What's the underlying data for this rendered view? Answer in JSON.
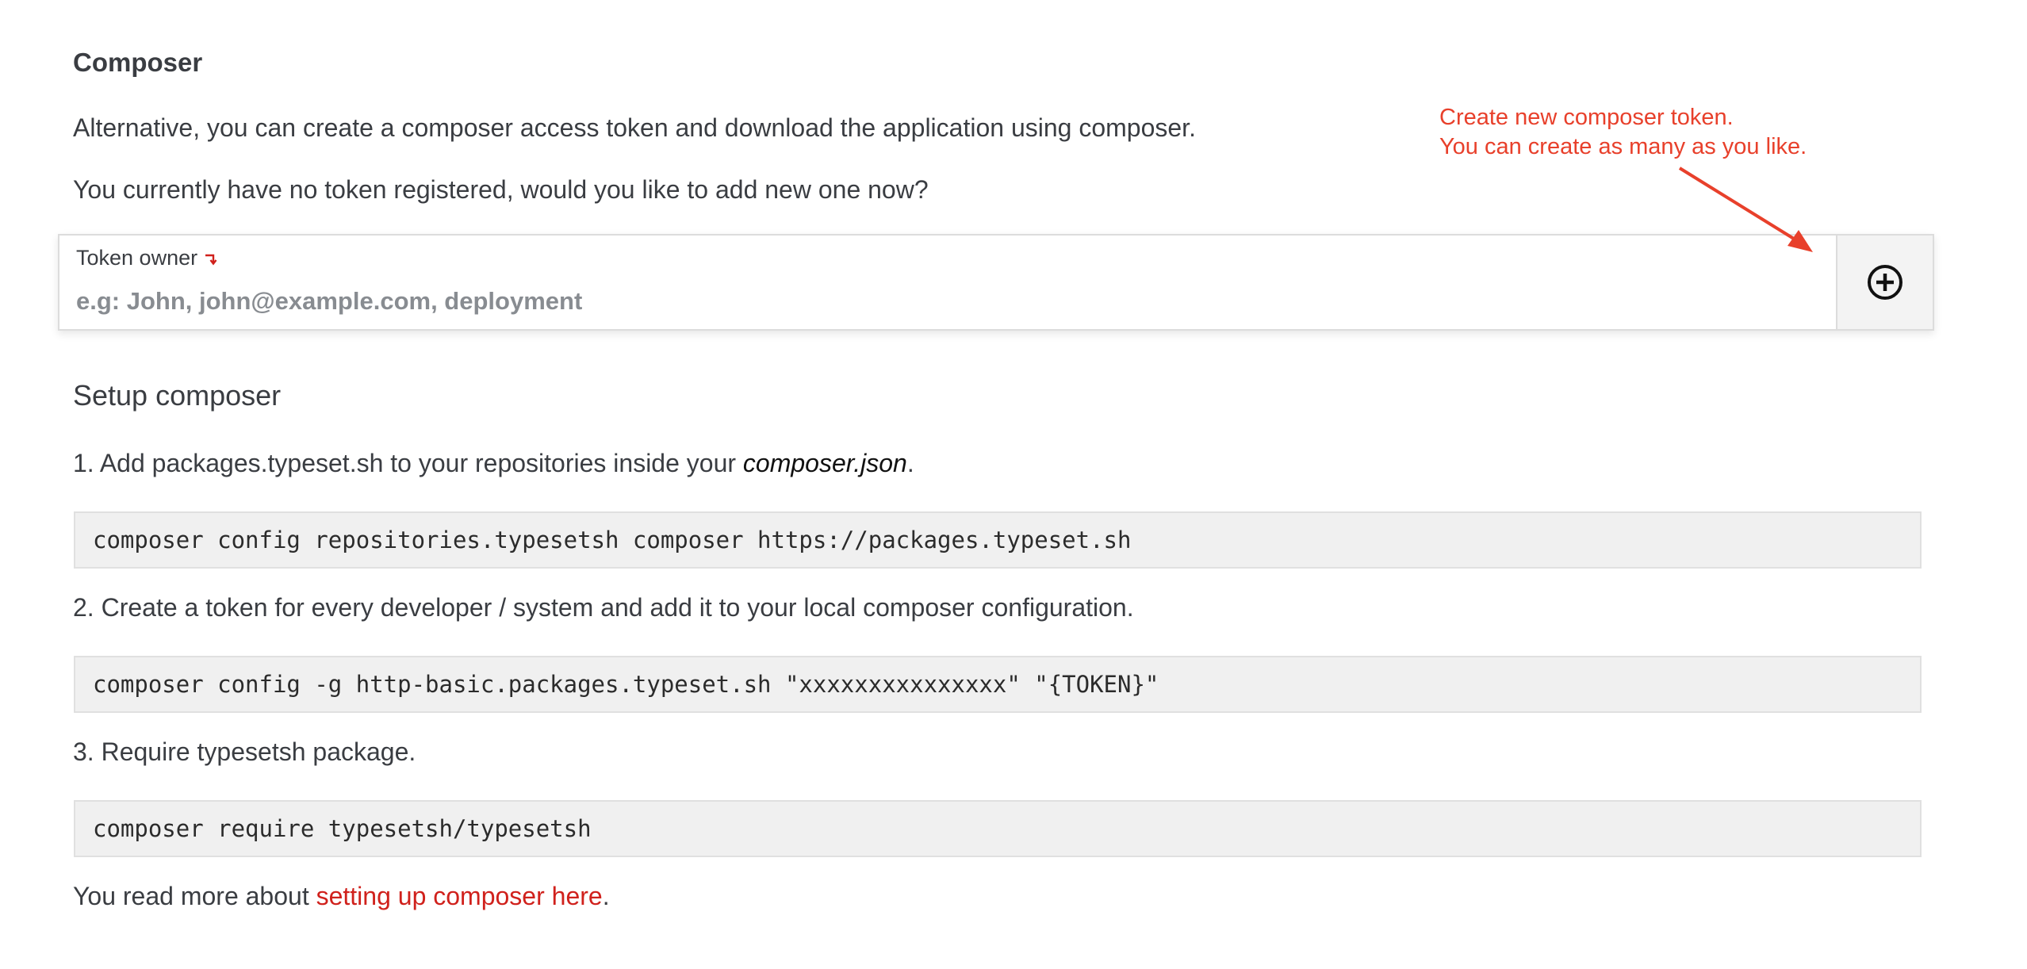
{
  "composer": {
    "title": "Composer",
    "intro": "Alternative, you can create a composer access token and download the application using composer.",
    "no_token": "You currently have no token registered, would you like to add new one now?"
  },
  "token_form": {
    "label": "Token owner",
    "placeholder": "e.g: John, john@example.com, deployment",
    "value": "",
    "add_icon": "plus-circle-icon",
    "required_icon": "arrow-turn-down-icon"
  },
  "setup": {
    "title": "Setup composer",
    "steps": [
      {
        "text_before": "1. Add packages.typeset.sh to your repositories inside your ",
        "emphasis": "composer.json",
        "text_after": ".",
        "code": "composer config repositories.typesetsh composer https://packages.typeset.sh"
      },
      {
        "text": "2. Create a token for every developer / system and add it to your local composer configuration.",
        "code": "composer config -g http-basic.packages.typeset.sh \"xxxxxxxxxxxxxxx\" \"{TOKEN}\""
      },
      {
        "text": "3. Require typesetsh package.",
        "code": "composer require typesetsh/typesetsh"
      }
    ]
  },
  "footer": {
    "prefix": "You read more about ",
    "link_text": "setting up composer here",
    "suffix": "."
  },
  "annotation": {
    "line1": "Create new composer token.",
    "line2": "You can create as many as you like."
  },
  "colors": {
    "text": "#3a3d42",
    "link": "#d0211c",
    "annotation": "#e8402b",
    "code_bg": "#f0f0f0"
  }
}
